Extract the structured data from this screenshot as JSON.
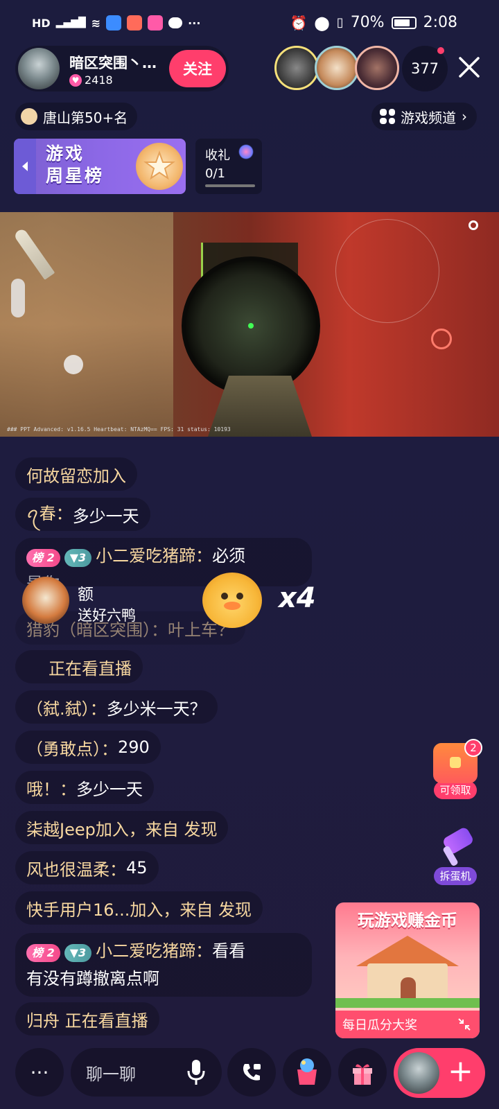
{
  "status_bar": {
    "left_label": "HD",
    "battery": "70%",
    "time": "2:08",
    "more": "···"
  },
  "host": {
    "name": "暗区突围丶…",
    "likes": "2418",
    "follow_label": "关注"
  },
  "viewer_count": "377",
  "rank_label": "唐山第50+名",
  "channel_label": "游戏频道",
  "weekstar": {
    "line1": "游戏",
    "line2": "周星榜"
  },
  "gift_task": {
    "title": "收礼",
    "progress": "0/1",
    "fraction": 0
  },
  "game_hud": {
    "bottom_text": "### PPT Advanced: v1.16.5   Heartbeat: NTAzMQ==   FPS: 31   status: 10193"
  },
  "chat": {
    "m1": "何故留恋加入",
    "m2_name": "ꪖ春：",
    "m2_text": "多少一天",
    "m3_badge1": "榜 2",
    "m3_badge2": "3",
    "m3_name": "小二爱吃猪蹄：",
    "m3_text": "必须",
    "m3_partial": "是你",
    "m4": "猎豹（暗区突围）：叶上车？",
    "m5": "正在看直播",
    "m6_name": "（弑.弑）：",
    "m6_text": "多少米一天？",
    "m7_name": "（勇敢点）：",
    "m7_text": "290",
    "m8_name": "哦！：",
    "m8_text": "多少一天",
    "m9": "柒越Jeep加入，来自 发现",
    "m10_name": "风也很温柔：",
    "m10_text": "45",
    "m11": "快手用户16...加入，来自 发现",
    "m12_badge1": "榜 2",
    "m12_badge2": "3",
    "m12_name": "小二爱吃猪蹄：",
    "m12_text": "看看",
    "m12_line2": "有没有蹲撤离点啊",
    "m13": "归舟 正在看直播"
  },
  "gift_banner": {
    "sender": "额",
    "desc": "送好六鸭",
    "count": "x4"
  },
  "side": {
    "chest_label": "可领取",
    "chest_badge": "2",
    "hammer_label": "拆蛋机"
  },
  "promo": {
    "title": "玩游戏赚金币",
    "bottom": "每日瓜分大奖"
  },
  "bottom": {
    "chat_placeholder": "聊一聊",
    "more": "···",
    "plus": "+"
  },
  "colors": {
    "accent": "#ff3e6c",
    "chat_name": "#f8d8a0",
    "background": "#1e1c3f"
  }
}
